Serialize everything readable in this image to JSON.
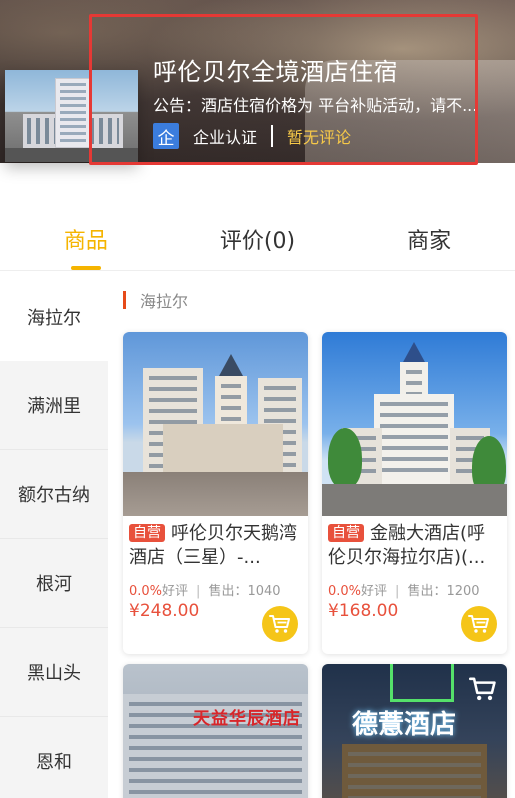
{
  "header": {
    "store_title": "呼伦贝尔全境酒店住宿",
    "notice": "公告：酒店住宿价格为 平台补贴活动，请不...",
    "cert_badge_char": "企",
    "cert_label": "企业认证",
    "no_review_label": "暂无评论",
    "highlight_color": "#e53935"
  },
  "tabs": [
    {
      "label": "商品",
      "active": true
    },
    {
      "label": "评价(0)",
      "active": false
    },
    {
      "label": "商家",
      "active": false
    }
  ],
  "categories": [
    {
      "label": "海拉尔",
      "active": true
    },
    {
      "label": "满洲里",
      "active": false
    },
    {
      "label": "额尔古纳",
      "active": false
    },
    {
      "label": "根河",
      "active": false
    },
    {
      "label": "黑山头",
      "active": false
    },
    {
      "label": "恩和",
      "active": false
    }
  ],
  "section_title": "海拉尔",
  "products": [
    {
      "tag": "自营",
      "name": "呼伦贝尔天鹅湾酒店（三星）-...",
      "rating_pct": "0.0%",
      "rating_label": "好评",
      "sales_label": "售出：",
      "sales": "1040",
      "price": "¥248.00"
    },
    {
      "tag": "自营",
      "name": "金融大酒店(呼伦贝尔海拉尔店)(...",
      "rating_pct": "0.0%",
      "rating_label": "好评",
      "sales_label": "售出：",
      "sales": "1200",
      "price": "¥168.00"
    },
    {
      "sign_text": "天益华辰酒店"
    },
    {
      "sign_text": "德薏酒店"
    }
  ],
  "icons": {
    "cart": "cart-icon",
    "cert": "enterprise-cert-icon"
  },
  "colors": {
    "accent": "#f5b400",
    "price": "#e8513c",
    "cart_button": "#f5c518",
    "cert_blue": "#3b7ddd"
  }
}
